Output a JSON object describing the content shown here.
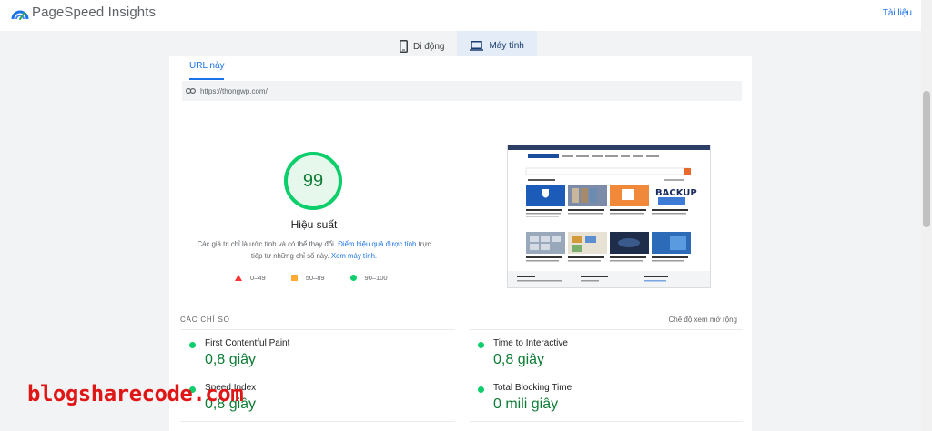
{
  "app": {
    "brand": "PageSpeed Insights",
    "docs_link": "Tài liệu"
  },
  "device_tabs": [
    {
      "label": "Di động",
      "icon": "phone-icon",
      "active": false
    },
    {
      "label": "Máy tính",
      "icon": "laptop-icon",
      "active": true
    }
  ],
  "url_section": {
    "tab_label": "URL này",
    "url": "https://thongwp.com/"
  },
  "performance": {
    "score": "99",
    "score_fraction": 0.99,
    "title": "Hiệu suất",
    "desc_text": "Các giá trị chỉ là ước tính và có thể thay đổi.",
    "desc_link1": "Điểm hiệu quả được tính",
    "desc_text2": "trực tiếp từ những chỉ số này.",
    "desc_link2": "Xem máy tính.",
    "legend": [
      {
        "range": "0–49",
        "shape": "triangle",
        "color": "#ff3333"
      },
      {
        "range": "50–89",
        "shape": "square",
        "color": "#ffaa33"
      },
      {
        "range": "90–100",
        "shape": "circle",
        "color": "#0cce6b"
      }
    ]
  },
  "thumbnail": {
    "site_name": "ThongWP.Com",
    "banner_text": "BACKUP"
  },
  "metrics": {
    "header": "CÁC CHỈ SỐ",
    "expand_label": "Chế độ xem mở rộng",
    "items": [
      {
        "name": "First Contentful Paint",
        "value": "0,8 giây"
      },
      {
        "name": "Time to Interactive",
        "value": "0,8 giây"
      },
      {
        "name": "Speed Index",
        "value": "0,8 giây"
      },
      {
        "name": "Total Blocking Time",
        "value": "0 mili giây"
      }
    ]
  },
  "watermark": "blogsharecode.com",
  "colors": {
    "accent": "#1a73e8",
    "pass": "#0cce6b",
    "pass_text": "#0c7c34",
    "average": "#ffaa33",
    "fail": "#ff3333"
  }
}
